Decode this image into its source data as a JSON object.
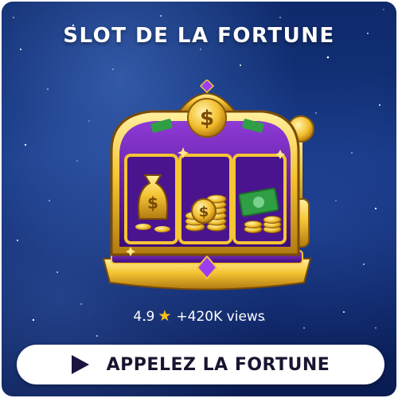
{
  "card": {
    "title": "SLOT DE LA FORTUNE",
    "machine_icon": "slot-machine-icon",
    "rating": "4.9",
    "rating_icon": "star-icon",
    "views": "+420K views",
    "cta_label": "APPELEZ LA FORTUNE",
    "cta_icon": "play-icon"
  },
  "colors": {
    "background": "#14347e",
    "accent_gold": "#f5c534",
    "accent_purple": "#6a1fb0",
    "button_bg": "#ffffff",
    "button_text": "#1a1430",
    "star": "#ffc21a"
  }
}
